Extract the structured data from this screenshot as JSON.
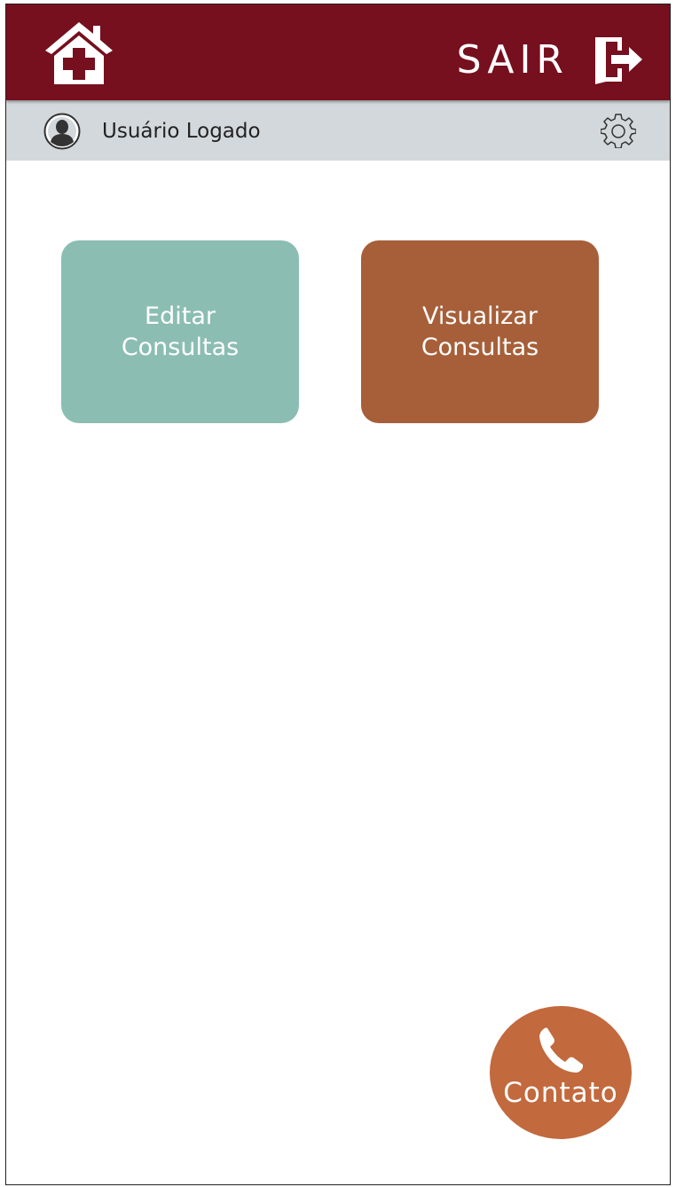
{
  "header": {
    "home_icon": "home-medical-cross-icon",
    "logout_label": "SAIR",
    "logout_icon": "door-exit-arrow-icon",
    "background_color": "#760f1e"
  },
  "user_bar": {
    "avatar_icon": "user-avatar-icon",
    "user_name": "Usuário Logado",
    "settings_icon": "gear-icon",
    "background_color": "#d3d8dc"
  },
  "tiles": [
    {
      "line1": "Editar",
      "line2": "Consultas",
      "color": "#8bbdb3"
    },
    {
      "line1": "Visualizar",
      "line2": "Consultas",
      "color": "#a65f39"
    }
  ],
  "contact": {
    "label": "Contato",
    "icon": "phone-icon",
    "color": "#c2693d"
  }
}
